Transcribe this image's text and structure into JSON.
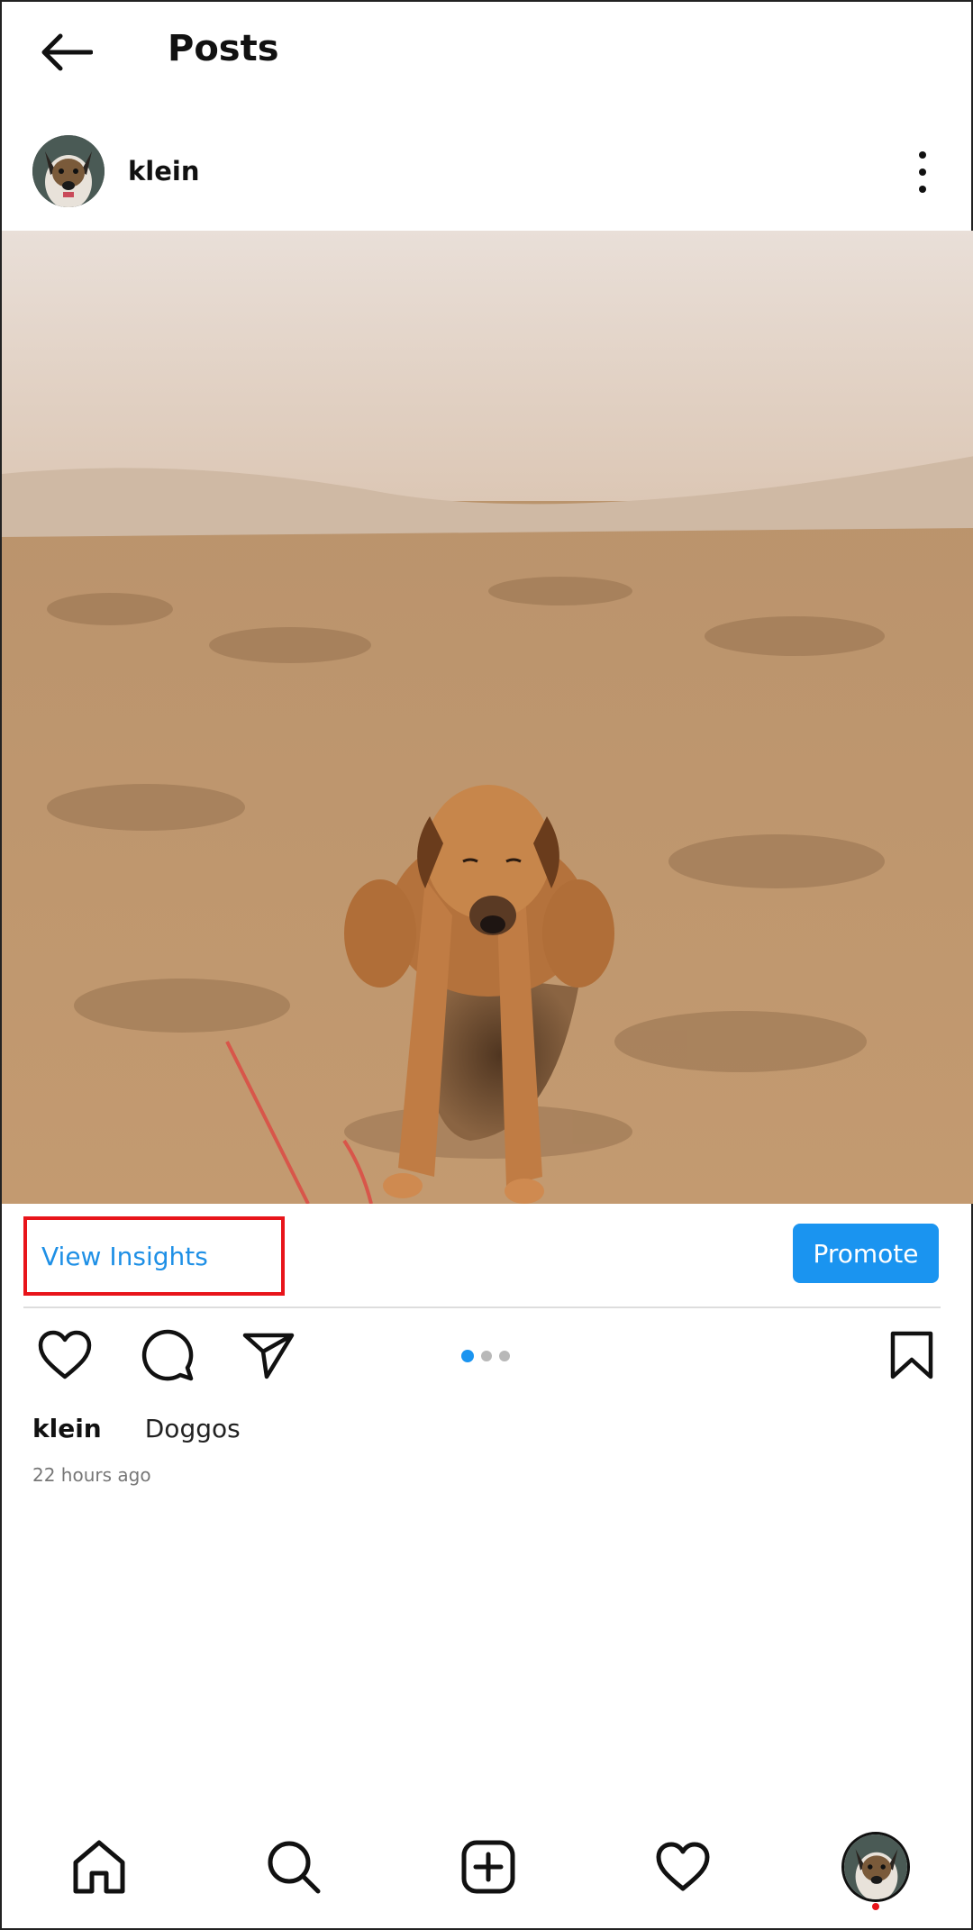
{
  "header": {
    "title": "Posts",
    "back_icon": "arrow-left-icon"
  },
  "post": {
    "username": "klein",
    "image": "dog-lying-in-sand-hole",
    "view_insights_label": "View Insights",
    "promote_label": "Promote",
    "caption_user": "klein",
    "caption_text": "Doggos",
    "timestamp": "22 hours ago",
    "carousel": {
      "count": 3,
      "active_index": 0
    }
  },
  "colors": {
    "accent": "#1a94f0",
    "highlight_box": "#e8141a",
    "link": "#1f90e6"
  },
  "bottom_nav": {
    "items": [
      "home-icon",
      "search-icon",
      "add-post-icon",
      "activity-heart-icon",
      "profile-avatar"
    ]
  }
}
